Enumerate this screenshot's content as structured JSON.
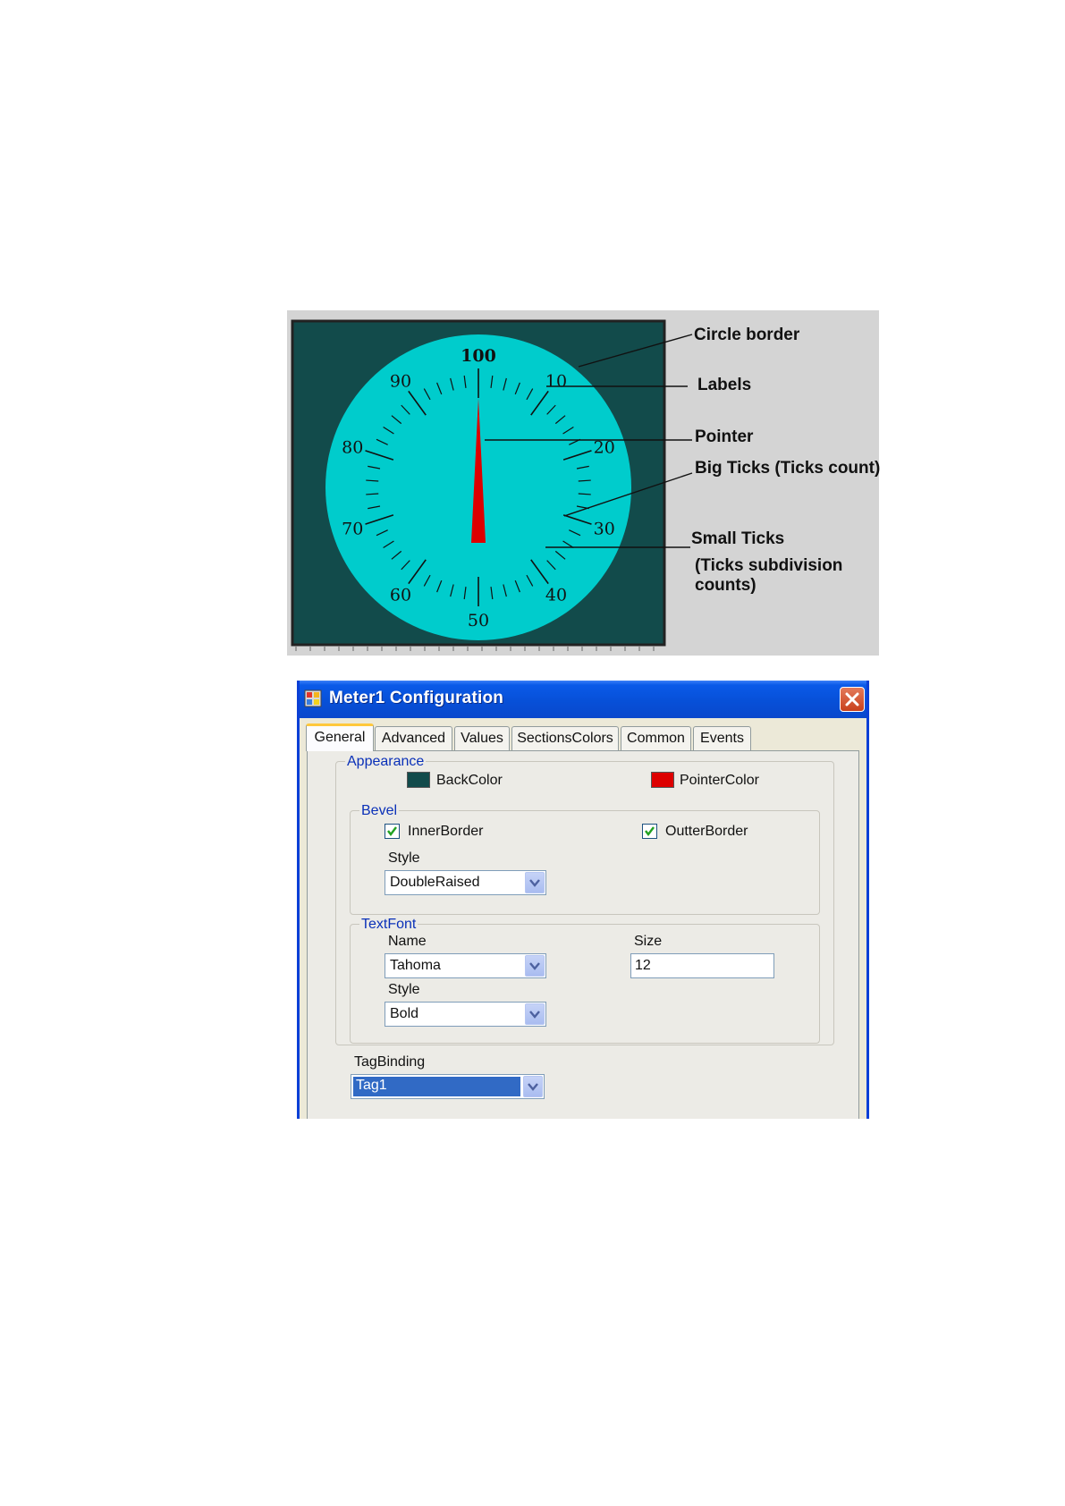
{
  "figure": {
    "colors": {
      "background": "#124b4b",
      "dial": "#00cccc",
      "pointer": "#dd0000",
      "ticks": "#111111"
    },
    "dial_labels": [
      "100",
      "10",
      "20",
      "30",
      "40",
      "50",
      "60",
      "70",
      "80",
      "90"
    ],
    "pointer_value": 0,
    "scale": {
      "min": 0,
      "max": 100,
      "big_ticks": 10,
      "small_ticks_per_division": 4
    },
    "callouts": {
      "circle_border": "Circle border",
      "labels": "Labels",
      "pointer": "Pointer",
      "big_ticks": "Big Ticks  (Ticks count)",
      "small_ticks": "Small Ticks",
      "small_ticks_note_1": "(Ticks subdivision",
      "small_ticks_note_2": "counts)"
    }
  },
  "dialog": {
    "title": "Meter1 Configuration",
    "tabs": [
      {
        "label": "General",
        "active": true
      },
      {
        "label": "Advanced"
      },
      {
        "label": "Values"
      },
      {
        "label": "SectionsColors"
      },
      {
        "label": "Common"
      },
      {
        "label": "Events"
      }
    ],
    "appearance": {
      "group_label": "Appearance",
      "backcolor_label": "BackColor",
      "backcolor": "#124b4b",
      "pointercolor_label": "PointerColor",
      "pointercolor": "#dd0000"
    },
    "bevel": {
      "group_label": "Bevel",
      "inner_border_label": "InnerBorder",
      "inner_border_checked": true,
      "outer_border_label": "OutterBorder",
      "outer_border_checked": true,
      "style_label": "Style",
      "style_value": "DoubleRaised"
    },
    "textfont": {
      "group_label": "TextFont",
      "name_label": "Name",
      "name_value": "Tahoma",
      "size_label": "Size",
      "size_value": "12",
      "style_label": "Style",
      "style_value": "Bold"
    },
    "tagbinding": {
      "label": "TagBinding",
      "value": "Tag1"
    }
  }
}
